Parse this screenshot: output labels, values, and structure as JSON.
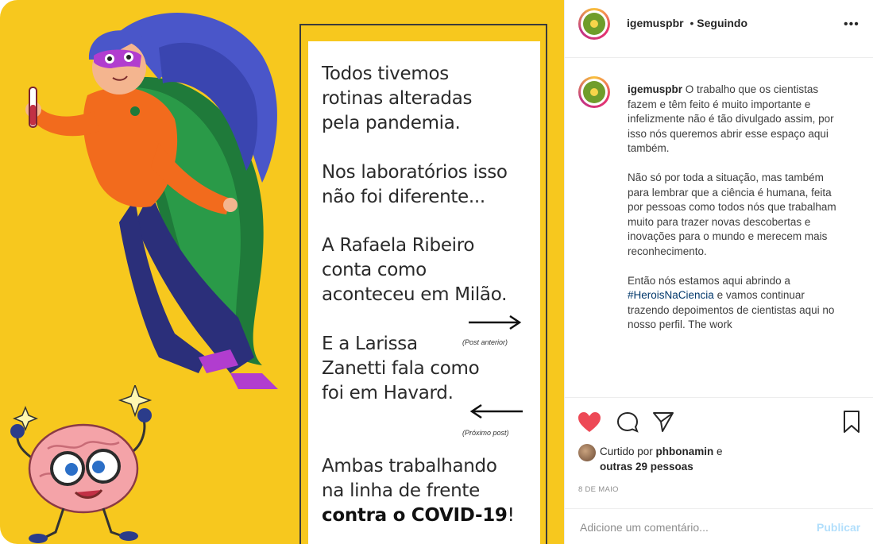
{
  "header": {
    "username": "igemuspbr",
    "separator": "•",
    "follow_status": "Seguindo",
    "more_icon": "more-horizontal-icon"
  },
  "post_image": {
    "lines": [
      "Todos tivemos\nrotinas alteradas\npela pandemia.",
      "Nos laboratórios isso\nnão foi diferente...",
      "A Rafaela Ribeiro\nconta como\naconteceu em Milão.",
      "E a Larissa\nZanetti fala como\nfoi em Havard.",
      "Ambas trabalhando\nna linha de frente"
    ],
    "bold_line": "contra o COVID-19",
    "bold_suffix": "!",
    "arrow_right_label": "(Post anterior)",
    "arrow_left_label": "(Próximo post)",
    "colors": {
      "background": "#f7c81e",
      "card": "#ffffff",
      "cape": "#1f7a3a",
      "shirt": "#f26b1d",
      "pants": "#2b2f7a",
      "hair": "#4a56c9"
    }
  },
  "caption": {
    "username": "igemuspbr",
    "text_before_tag": " O trabalho que os cientistas fazem e têm feito é muito importante e infelizmente não é tão divulgado assim, por isso nós queremos abrir esse espaço aqui também.\n\nNão só por toda a situação, mas também para lembrar que a ciência é humana, feita por pessoas como todos nós que trabalham muito para trazer novas descobertas e inovações para o mundo e merecem mais reconhecimento.\n\nEntão nós estamos aqui abrindo a ",
    "hashtag": "#HeroisNaCiencia",
    "text_after_tag": " e vamos continuar trazendo depoimentos de cientistas aqui no nosso perfil.         The work"
  },
  "actions": {
    "like_icon": "heart-filled-icon",
    "comment_icon": "comment-icon",
    "share_icon": "send-icon",
    "save_icon": "bookmark-icon",
    "liked_color": "#ed4956"
  },
  "likes": {
    "prefix": "Curtido por ",
    "user": "phbonamin",
    "middle": " e",
    "others": "outras 29 pessoas"
  },
  "date": "8 DE MAIO",
  "comment": {
    "placeholder": "Adicione um comentário...",
    "publish_label": "Publicar"
  }
}
